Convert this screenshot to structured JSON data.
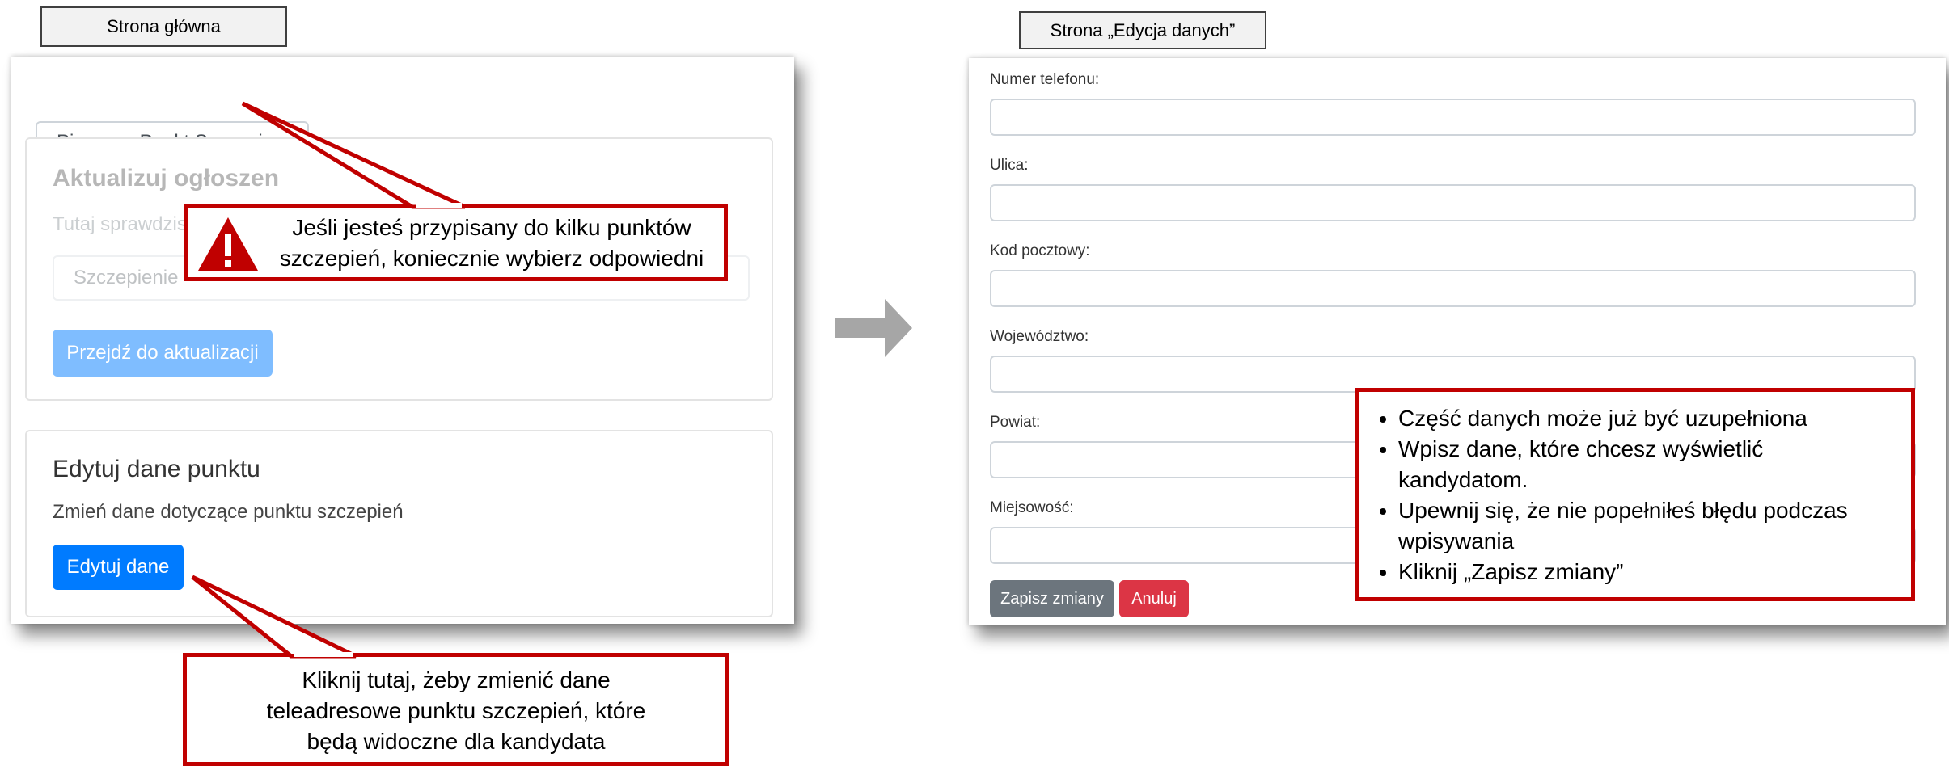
{
  "labels": {
    "home_page": "Strona główna",
    "edit_page": "Strona „Edycja danych”"
  },
  "home": {
    "point_select": "Pierwszy Punkt Szczepien",
    "update_card": {
      "title": "Aktualizuj ogłoszen",
      "text": "Tutaj sprawdzis",
      "select_value": "Szczepienie",
      "button": "Przejdź do aktualizacji"
    },
    "edit_card": {
      "title": "Edytuj dane punktu",
      "text": "Zmień dane dotyczące punktu szczepień",
      "button": "Edytuj dane"
    }
  },
  "edit_form": {
    "fields": [
      {
        "label": "Numer telefonu:",
        "value": ""
      },
      {
        "label": "Ulica:",
        "value": ""
      },
      {
        "label": "Kod pocztowy:",
        "value": ""
      },
      {
        "label": "Województwo:",
        "value": ""
      },
      {
        "label": "Powiat:",
        "value": ""
      },
      {
        "label": "Miejsowość:",
        "value": ""
      }
    ],
    "save_button": "Zapisz zmiany",
    "cancel_button": "Anuluj"
  },
  "callouts": {
    "warning_line1": "Jeśli jesteś przypisany do kilku punktów",
    "warning_line2": "szczepień, koniecznie wybierz odpowiedni",
    "edit_hint_line1": "Kliknij tutaj, żeby zmienić dane",
    "edit_hint_line2": "teleadresowe punktu szczepień, które",
    "edit_hint_line3": "będą widoczne dla kandydata",
    "tips": [
      "Część danych może już być uzupełniona",
      "Wpisz dane, które chcesz wyświetlić kandydatom.",
      "Upewnij się, że nie popełniłeś błędu podczas wpisywania",
      "Kliknij „Zapisz zmiany”"
    ]
  },
  "colors": {
    "callout_border": "#c00000",
    "primary": "#007bff",
    "secondary": "#6c757d",
    "danger": "#dc3545",
    "arrow": "#a6a6a6"
  },
  "icons": {
    "warning": "warning-triangle-icon",
    "arrow": "right-arrow-icon",
    "dropdown": "chevron-down-icon"
  }
}
